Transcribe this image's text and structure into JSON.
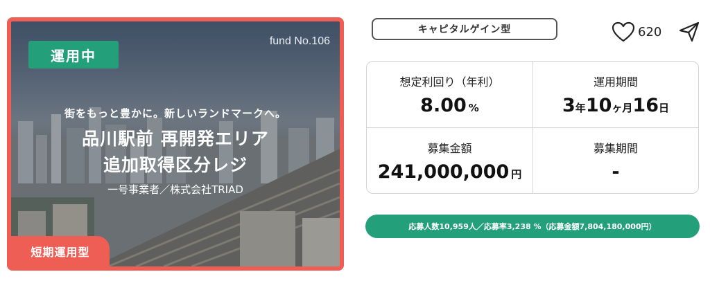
{
  "card": {
    "status_badge": "運用中",
    "fund_no": "fund No.106",
    "tagline": "街をもっと豊かに。新しいランドマークへ。",
    "title_line1": "品川駅前 再開発エリア",
    "title_line2": "追加取得区分レジ",
    "operator": "一号事業者／株式会社TRIAD",
    "type_badge": "短期運用型"
  },
  "category": "キャピタルゲイン型",
  "likes": {
    "count": "620",
    "icon": "heart-icon"
  },
  "share": {
    "icon": "send-icon"
  },
  "stats": {
    "yield_label": "想定利回り（年利）",
    "yield_value": "8.00",
    "yield_unit": "%",
    "period_label": "運用期間",
    "period": {
      "years": "3",
      "y_unit": "年",
      "months": "10",
      "m_unit": "ヶ月",
      "days": "16",
      "d_unit": "日"
    },
    "amount_label": "募集金額",
    "amount_value": "241,000,000",
    "amount_unit": "円",
    "recruit_label": "募集期間",
    "recruit_value": "-"
  },
  "progress": {
    "text": "応募人数10,959人／応募率3,238 %（応募金額7,804,180,000円）",
    "fill_fraction": 1.0
  },
  "colors": {
    "accent_red": "#ee5e55",
    "accent_green": "#23a07a"
  }
}
